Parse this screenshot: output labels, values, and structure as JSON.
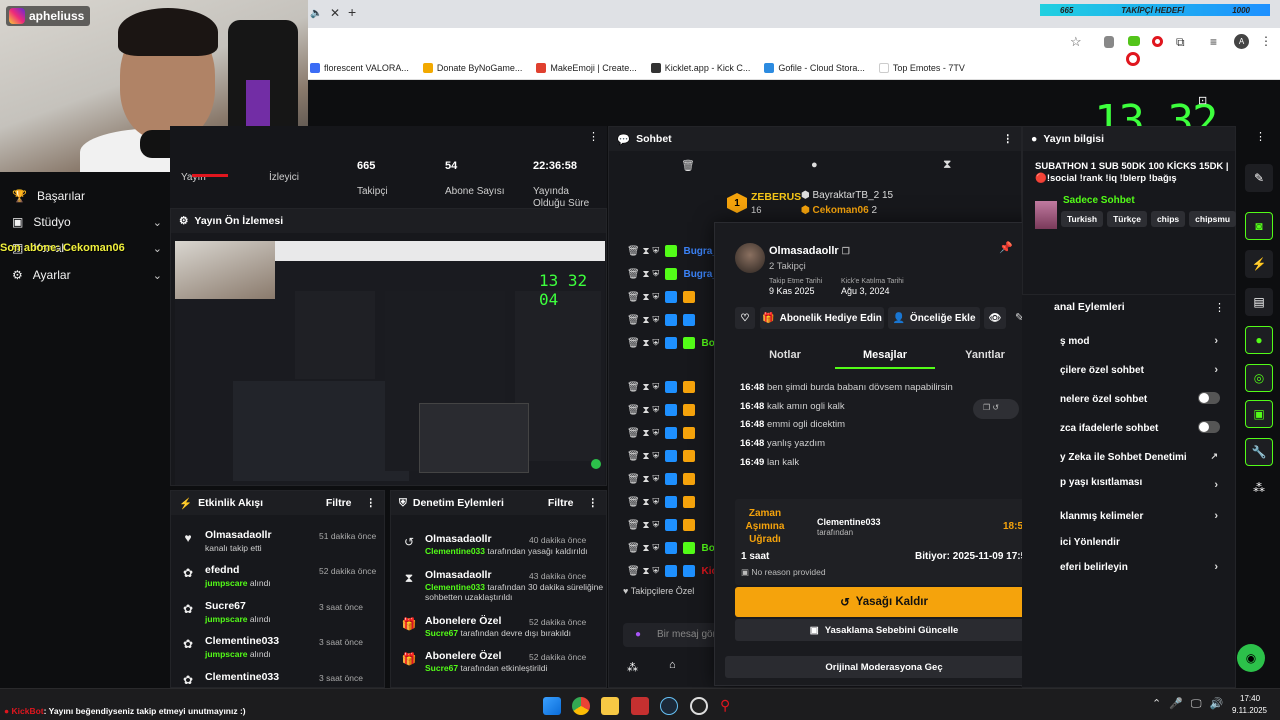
{
  "stream": {
    "handle": "apheliuss",
    "clock": "13 32 01",
    "follower_goal_current": "665",
    "follower_goal_label": "TAKİPÇİ HEDEFİ",
    "follower_goal_target": "1000"
  },
  "browser": {
    "bookmarks": [
      "florescent VALORA...",
      "Donate ByNoGame...",
      "MakeEmoji | Create...",
      "Kicklet.app - Kick C...",
      "Gofile - Cloud Stora...",
      "Top Emotes - 7TV"
    ],
    "user_initial": "A"
  },
  "sidebar": {
    "items": [
      {
        "label": "Başarılar",
        "icon": "trophy-icon"
      },
      {
        "label": "Stüdyo",
        "icon": "studio-icon"
      },
      {
        "label": "Kanal",
        "icon": "channel-icon"
      },
      {
        "label": "Ayarlar",
        "icon": "gear-icon"
      }
    ],
    "overlay_text": "Son abone: Cekoman06"
  },
  "stats": [
    {
      "value": "",
      "label": "Yayın"
    },
    {
      "value": "",
      "label": "İzleyici"
    },
    {
      "value": "665",
      "label": "Takipçi"
    },
    {
      "value": "54",
      "label": "Abone Sayısı"
    },
    {
      "value": "22:36:58",
      "label": "Yayında Olduğu Süre"
    }
  ],
  "preview": {
    "title": "Yayın Ön İzlemesi",
    "clock": "13 32 04"
  },
  "activity": {
    "title": "Etkinlik Akışı",
    "filter": "Filtre",
    "items": [
      {
        "name": "Olmasadaollr",
        "sub": "kanalı takip etti",
        "highlight": "",
        "time": "51 dakika önce",
        "icon": "heart-icon"
      },
      {
        "name": "efednd",
        "sub": "alındı",
        "highlight": "jumpscare",
        "time": "52 dakika önce",
        "icon": "gift-icon"
      },
      {
        "name": "Sucre67",
        "sub": "alındı",
        "highlight": "jumpscare",
        "time": "3 saat önce",
        "icon": "gift-icon"
      },
      {
        "name": "Clementine033",
        "sub": "alındı",
        "highlight": "jumpscare",
        "time": "3 saat önce",
        "icon": "gift-icon"
      },
      {
        "name": "Clementine033",
        "sub": "",
        "highlight": "",
        "time": "3 saat önce",
        "icon": "gift-icon"
      }
    ]
  },
  "moderation": {
    "title": "Denetim Eylemleri",
    "filter": "Filtre",
    "items": [
      {
        "name": "Olmasadaollr",
        "highlight": "Clementine033",
        "sub": " tarafından yasağı kaldırıldı",
        "time": "40 dakika önce",
        "icon": "undo-icon"
      },
      {
        "name": "Olmasadaollr",
        "highlight": "Clementine033",
        "sub": " tarafından 30 dakika süreliğine sohbetten uzaklaştırıldı",
        "time": "43 dakika önce",
        "icon": "hourglass-icon"
      },
      {
        "name": "Abonelere Özel",
        "highlight": "Sucre67",
        "sub": " tarafından devre dışı bırakıldı",
        "time": "52 dakika önce",
        "icon": "gift-icon"
      },
      {
        "name": "Abonelere Özel",
        "highlight": "Sucre67",
        "sub": " tarafından etkinleştirildi",
        "time": "52 dakika önce",
        "icon": "gift-icon"
      }
    ]
  },
  "chat": {
    "title": "Sohbet",
    "leaderboard": {
      "rank": "1",
      "top_name": "ZEBERUS",
      "top_count": "16",
      "second_name": "BayraktarTB_2",
      "second_count": "15",
      "third_name": "Cekoman06",
      "third_count": "2"
    },
    "usernames": [
      "Bugra_",
      "Bugra_",
      "Bot",
      "Bot",
      "Kic"
    ],
    "followers_only": "Takipçilere Özel",
    "input_placeholder": "Bir mesaj gön"
  },
  "profile": {
    "username": "Olmasadaollr",
    "followers": "2 Takipçi",
    "follow_date_label": "Takip Etme Tarihi",
    "follow_date": "9 Kas 2025",
    "join_date_label": "Kick'e Katılma Tarihi",
    "join_date": "Ağu 3, 2024",
    "gift_sub": "Abonelik Hediye Edin",
    "add_priority": "Önceliğe Ekle",
    "tabs": [
      "Notlar",
      "Mesajlar",
      "Yanıtlar"
    ],
    "messages": [
      {
        "time": "16:48",
        "text": "ben şimdi burda babanı dövsem napabilirsin"
      },
      {
        "time": "16:48",
        "text": "kalk amın ogli kalk"
      },
      {
        "time": "16:48",
        "text": "emmi ogli dicektim"
      },
      {
        "time": "16:48",
        "text": "yanlış yazdım"
      },
      {
        "time": "16:49",
        "text": "lan kalk"
      }
    ],
    "ban": {
      "type": "Zaman Aşımına Uğradı",
      "moderator": "Clementine033",
      "by": "tarafından",
      "time": "18:57",
      "duration": "1 saat",
      "ends": "Bitiyor: 2025-11-09 17:59",
      "reason": "No reason provided"
    },
    "unban": "Yasağı Kaldır",
    "update_reason": "Yasaklama Sebebini Güncelle",
    "original_mod": "Orijinal Moderasyona Geç"
  },
  "info": {
    "title": "Yayın bilgisi",
    "stream_title": "SUBATHON 1 SUB 50DK 100 KİCKS 15DK | 🔴!social !rank !iq !blerp !bağış",
    "category": "Sadece Sohbet",
    "tags": [
      "Turkish",
      "Türkçe",
      "chips",
      "chipsmu"
    ]
  },
  "channel_actions": {
    "title": "anal Eylemleri",
    "items": [
      {
        "label": "ş mod",
        "control": "chevron"
      },
      {
        "label": "çilere özel sohbet",
        "control": "chevron"
      },
      {
        "label": "nelere özel sohbet",
        "control": "toggle"
      },
      {
        "label": "zca ifadelerle sohbet",
        "control": "toggle"
      },
      {
        "label": "y Zeka ile Sohbet Denetimi",
        "control": "external"
      },
      {
        "label": "p yaşı kısıtlaması",
        "control": "chevron"
      },
      {
        "label": "klanmış kelimeler",
        "control": "chevron"
      },
      {
        "label": "ici Yönlendir",
        "control": "none"
      },
      {
        "label": "eferi belirleyin",
        "control": "chevron"
      }
    ]
  },
  "bottom_bar": {
    "bot": "KickBot",
    "message": ": Yayını beğendiyseniz takip etmeyi unutmayınız :)"
  },
  "taskbar": {
    "time": "17:40",
    "date": "9.11.2025"
  },
  "colors": {
    "accent": "#53fc18",
    "warning": "#f5a30c",
    "leaderboard": "#f5c518"
  }
}
